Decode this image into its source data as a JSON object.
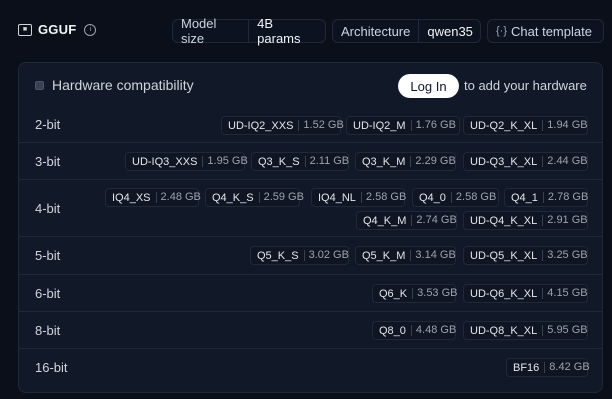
{
  "header": {
    "brand": "GGUF",
    "model_size_label": "Model size",
    "model_size_value": "4B params",
    "arch_label": "Architecture",
    "arch_value": "qwen35",
    "chat_template_label": "Chat template"
  },
  "hardware": {
    "title": "Hardware compatibility",
    "login_label": "Log In",
    "login_suffix": "to add your hardware"
  },
  "rows": [
    {
      "label": "2-bit",
      "quants": [
        {
          "name": "UD-IQ2_XXS",
          "size": "1.52 GB"
        },
        {
          "name": "UD-IQ2_M",
          "size": "1.76 GB"
        },
        {
          "name": "UD-Q2_K_XL",
          "size": "1.94 GB"
        }
      ]
    },
    {
      "label": "3-bit",
      "quants": [
        {
          "name": "UD-IQ3_XXS",
          "size": "1.95 GB"
        },
        {
          "name": "Q3_K_S",
          "size": "2.11 GB"
        },
        {
          "name": "Q3_K_M",
          "size": "2.29 GB"
        },
        {
          "name": "UD-Q3_K_XL",
          "size": "2.44 GB"
        }
      ]
    },
    {
      "label": "4-bit",
      "quants": [
        {
          "name": "IQ4_XS",
          "size": "2.48 GB"
        },
        {
          "name": "Q4_K_S",
          "size": "2.59 GB"
        },
        {
          "name": "IQ4_NL",
          "size": "2.58 GB"
        },
        {
          "name": "Q4_0",
          "size": "2.58 GB"
        },
        {
          "name": "Q4_1",
          "size": "2.78 GB"
        },
        {
          "name": "Q4_K_M",
          "size": "2.74 GB"
        },
        {
          "name": "UD-Q4_K_XL",
          "size": "2.91 GB"
        }
      ]
    },
    {
      "label": "5-bit",
      "quants": [
        {
          "name": "Q5_K_S",
          "size": "3.02 GB"
        },
        {
          "name": "Q5_K_M",
          "size": "3.14 GB"
        },
        {
          "name": "UD-Q5_K_XL",
          "size": "3.25 GB"
        }
      ]
    },
    {
      "label": "6-bit",
      "quants": [
        {
          "name": "Q6_K",
          "size": "3.53 GB"
        },
        {
          "name": "UD-Q6_K_XL",
          "size": "4.15 GB"
        }
      ]
    },
    {
      "label": "8-bit",
      "quants": [
        {
          "name": "Q8_0",
          "size": "4.48 GB"
        },
        {
          "name": "UD-Q8_K_XL",
          "size": "5.95 GB"
        }
      ]
    },
    {
      "label": "16-bit",
      "quants": [
        {
          "name": "BF16",
          "size": "8.42 GB"
        }
      ]
    }
  ]
}
